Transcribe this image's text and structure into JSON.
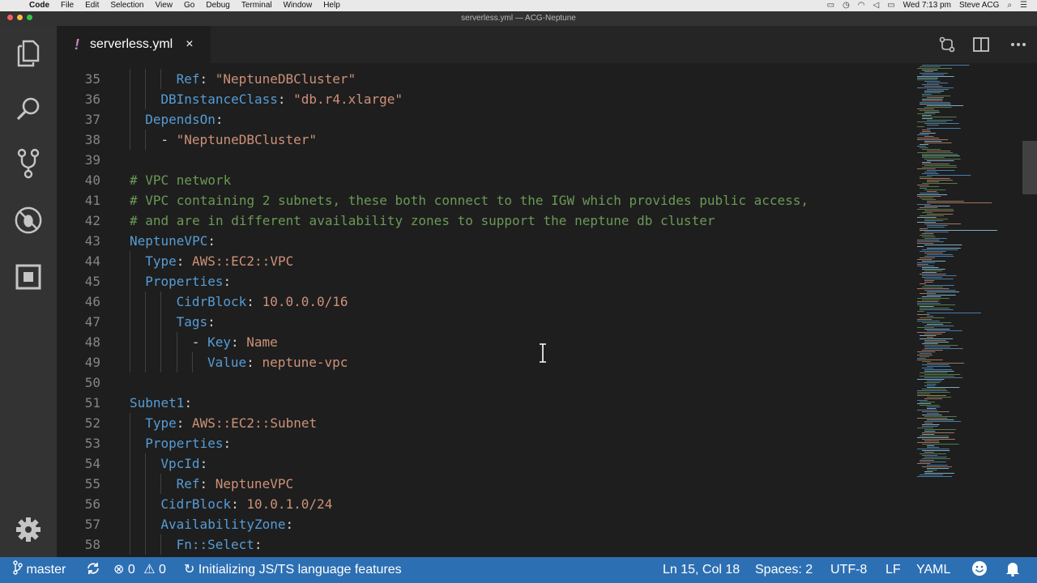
{
  "menubar": {
    "app": "Code",
    "menus": [
      "File",
      "Edit",
      "Selection",
      "View",
      "Go",
      "Debug",
      "Terminal",
      "Window",
      "Help"
    ],
    "clock": "Wed 7:13 pm",
    "user": "Steve ACG"
  },
  "window": {
    "title": "serverless.yml — ACG-Neptune"
  },
  "tab": {
    "modified_marker": "!",
    "filename": "serverless.yml",
    "close": "×"
  },
  "editor": {
    "lines": [
      {
        "n": "35",
        "indent": 3,
        "segs": [
          {
            "t": "Ref",
            "c": "k"
          },
          {
            "t": ": ",
            "c": "p"
          },
          {
            "t": "\"NeptuneDBCluster\"",
            "c": "s"
          }
        ]
      },
      {
        "n": "36",
        "indent": 2,
        "segs": [
          {
            "t": "DBInstanceClass",
            "c": "k"
          },
          {
            "t": ": ",
            "c": "p"
          },
          {
            "t": "\"db.r4.xlarge\"",
            "c": "s"
          }
        ]
      },
      {
        "n": "37",
        "indent": 1,
        "segs": [
          {
            "t": "DependsOn",
            "c": "k"
          },
          {
            "t": ":",
            "c": "p"
          }
        ]
      },
      {
        "n": "38",
        "indent": 2,
        "segs": [
          {
            "t": "- ",
            "c": "p"
          },
          {
            "t": "\"NeptuneDBCluster\"",
            "c": "s"
          }
        ]
      },
      {
        "n": "39",
        "indent": 0,
        "segs": []
      },
      {
        "n": "40",
        "indent": 0,
        "segs": [
          {
            "t": "# VPC network",
            "c": "c"
          }
        ]
      },
      {
        "n": "41",
        "indent": 0,
        "segs": [
          {
            "t": "# VPC containing 2 subnets, these both connect to the IGW which provides public access,",
            "c": "c"
          }
        ]
      },
      {
        "n": "42",
        "indent": 0,
        "segs": [
          {
            "t": "# and are in different availability zones to support the neptune db cluster",
            "c": "c"
          }
        ]
      },
      {
        "n": "43",
        "indent": 0,
        "segs": [
          {
            "t": "NeptuneVPC",
            "c": "k"
          },
          {
            "t": ":",
            "c": "p"
          }
        ]
      },
      {
        "n": "44",
        "indent": 1,
        "segs": [
          {
            "t": "Type",
            "c": "k"
          },
          {
            "t": ": ",
            "c": "p"
          },
          {
            "t": "AWS::EC2::VPC",
            "c": "s"
          }
        ]
      },
      {
        "n": "45",
        "indent": 1,
        "segs": [
          {
            "t": "Properties",
            "c": "k"
          },
          {
            "t": ":",
            "c": "p"
          }
        ]
      },
      {
        "n": "46",
        "indent": 3,
        "segs": [
          {
            "t": "CidrBlock",
            "c": "k"
          },
          {
            "t": ": ",
            "c": "p"
          },
          {
            "t": "10.0.0.0/16",
            "c": "s"
          }
        ]
      },
      {
        "n": "47",
        "indent": 3,
        "segs": [
          {
            "t": "Tags",
            "c": "k"
          },
          {
            "t": ":",
            "c": "p"
          }
        ]
      },
      {
        "n": "48",
        "indent": 4,
        "segs": [
          {
            "t": "- ",
            "c": "p"
          },
          {
            "t": "Key",
            "c": "k"
          },
          {
            "t": ": ",
            "c": "p"
          },
          {
            "t": "Name",
            "c": "s"
          }
        ]
      },
      {
        "n": "49",
        "indent": 5,
        "segs": [
          {
            "t": "Value",
            "c": "k"
          },
          {
            "t": ": ",
            "c": "p"
          },
          {
            "t": "neptune-vpc",
            "c": "s"
          }
        ]
      },
      {
        "n": "50",
        "indent": 0,
        "segs": []
      },
      {
        "n": "51",
        "indent": 0,
        "segs": [
          {
            "t": "Subnet1",
            "c": "k"
          },
          {
            "t": ":",
            "c": "p"
          }
        ]
      },
      {
        "n": "52",
        "indent": 1,
        "segs": [
          {
            "t": "Type",
            "c": "k"
          },
          {
            "t": ": ",
            "c": "p"
          },
          {
            "t": "AWS::EC2::Subnet",
            "c": "s"
          }
        ]
      },
      {
        "n": "53",
        "indent": 1,
        "segs": [
          {
            "t": "Properties",
            "c": "k"
          },
          {
            "t": ":",
            "c": "p"
          }
        ]
      },
      {
        "n": "54",
        "indent": 2,
        "segs": [
          {
            "t": "VpcId",
            "c": "k"
          },
          {
            "t": ":",
            "c": "p"
          }
        ]
      },
      {
        "n": "55",
        "indent": 3,
        "segs": [
          {
            "t": "Ref",
            "c": "k"
          },
          {
            "t": ": ",
            "c": "p"
          },
          {
            "t": "NeptuneVPC",
            "c": "s"
          }
        ]
      },
      {
        "n": "56",
        "indent": 2,
        "segs": [
          {
            "t": "CidrBlock",
            "c": "k"
          },
          {
            "t": ": ",
            "c": "p"
          },
          {
            "t": "10.0.1.0/24",
            "c": "s"
          }
        ]
      },
      {
        "n": "57",
        "indent": 2,
        "segs": [
          {
            "t": "AvailabilityZone",
            "c": "k"
          },
          {
            "t": ":",
            "c": "p"
          }
        ]
      },
      {
        "n": "58",
        "indent": 3,
        "segs": [
          {
            "t": "Fn::Select",
            "c": "k"
          },
          {
            "t": ":",
            "c": "p"
          }
        ]
      }
    ]
  },
  "statusbar": {
    "branch": "master",
    "errors": "0",
    "warnings": "0",
    "task": "Initializing JS/TS language features",
    "cursor": "Ln 15, Col 18",
    "spaces": "Spaces: 2",
    "encoding": "UTF-8",
    "eol": "LF",
    "language": "YAML"
  },
  "colors": {
    "status_bar": "#2d6fb3",
    "activity_bar": "#333333",
    "editor_bg": "#1e1e1e",
    "keyword": "#569cd6",
    "string": "#ce9178",
    "comment": "#6a9955"
  },
  "icons": {
    "activity": [
      "files-icon",
      "search-icon",
      "source-control-icon",
      "debug-icon",
      "extensions-icon"
    ],
    "manage": "gear-icon"
  }
}
